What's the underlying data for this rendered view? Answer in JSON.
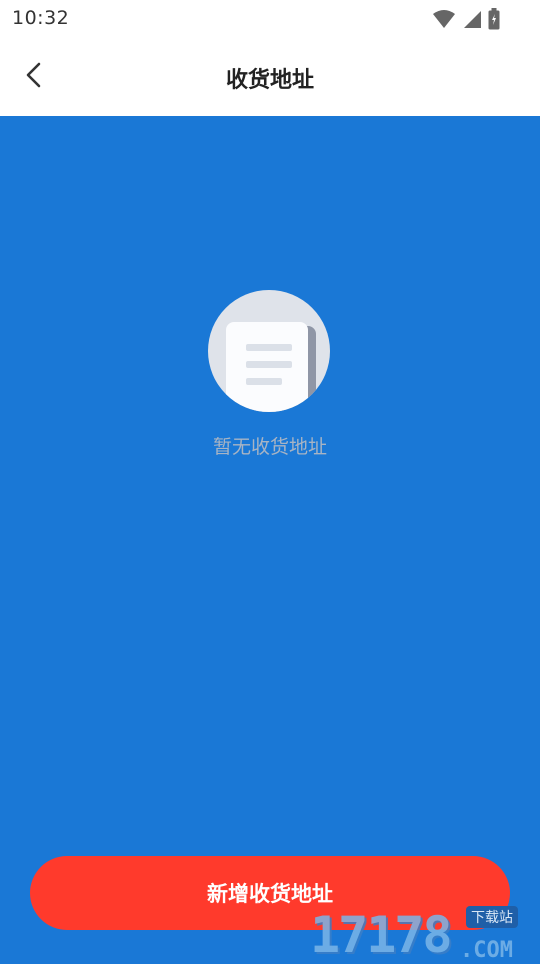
{
  "status_bar": {
    "time": "10:32",
    "icons": [
      "wifi-icon",
      "signal-icon",
      "battery-icon"
    ]
  },
  "header": {
    "back_icon": "chevron-left-icon",
    "title": "收货地址"
  },
  "empty_state": {
    "icon": "document-icon",
    "message": "暂无收货地址"
  },
  "footer": {
    "add_button_label": "新增收货地址"
  },
  "watermark": {
    "digits": "17178",
    "domain": ".COM",
    "badge": "下载站"
  },
  "colors": {
    "content_background": "#1a78d6",
    "primary_button": "#ff3a2c",
    "empty_text": "#a8b4c4"
  }
}
